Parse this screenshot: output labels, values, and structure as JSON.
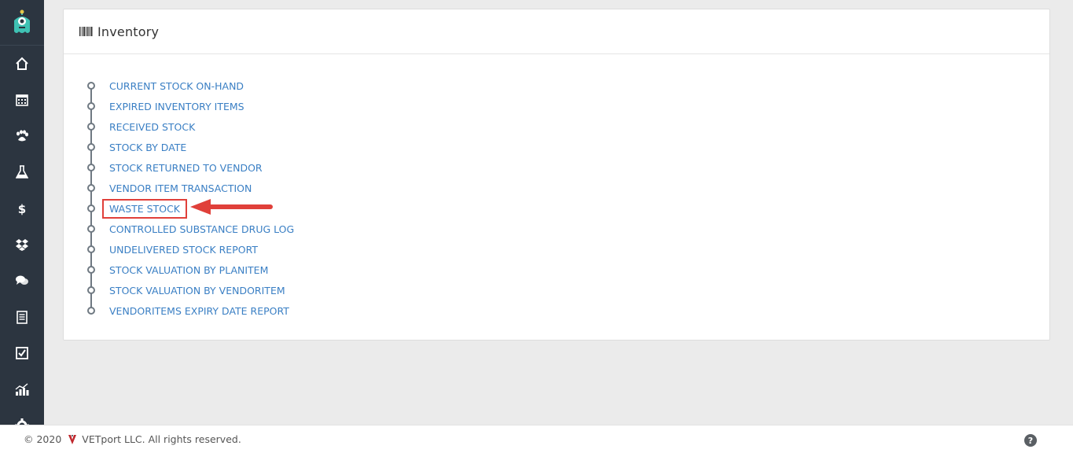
{
  "sidebar": {
    "logo_icon": "monster-logo-icon",
    "items": [
      {
        "icon": "home-icon"
      },
      {
        "icon": "calendar-icon"
      },
      {
        "icon": "paw-icon"
      },
      {
        "icon": "flask-icon"
      },
      {
        "icon": "dollar-icon"
      },
      {
        "icon": "dropbox-icon"
      },
      {
        "icon": "chat-icon"
      },
      {
        "icon": "document-icon"
      },
      {
        "icon": "checkbox-icon"
      },
      {
        "icon": "chart-icon"
      },
      {
        "icon": "gear-icon"
      }
    ]
  },
  "panel": {
    "title": "Inventory",
    "links": [
      {
        "label": "CURRENT STOCK ON-HAND"
      },
      {
        "label": "EXPIRED INVENTORY ITEMS"
      },
      {
        "label": "RECEIVED STOCK"
      },
      {
        "label": "STOCK BY DATE"
      },
      {
        "label": "STOCK RETURNED TO VENDOR"
      },
      {
        "label": "VENDOR ITEM TRANSACTION"
      },
      {
        "label": "WASTE STOCK"
      },
      {
        "label": "CONTROLLED SUBSTANCE DRUG LOG"
      },
      {
        "label": "UNDELIVERED STOCK REPORT"
      },
      {
        "label": "STOCK VALUATION BY PLANITEM"
      },
      {
        "label": "STOCK VALUATION BY VENDORITEM"
      },
      {
        "label": "VENDORITEMS EXPIRY DATE REPORT"
      }
    ]
  },
  "footer": {
    "copyright": "© 2020",
    "company": "VETport LLC. All rights reserved.",
    "help_label": "?"
  },
  "colors": {
    "sidebar_bg": "#2c3540",
    "link": "#3a7fc4",
    "highlight": "#e0403a",
    "brand_accent": "#3fc1b3"
  }
}
